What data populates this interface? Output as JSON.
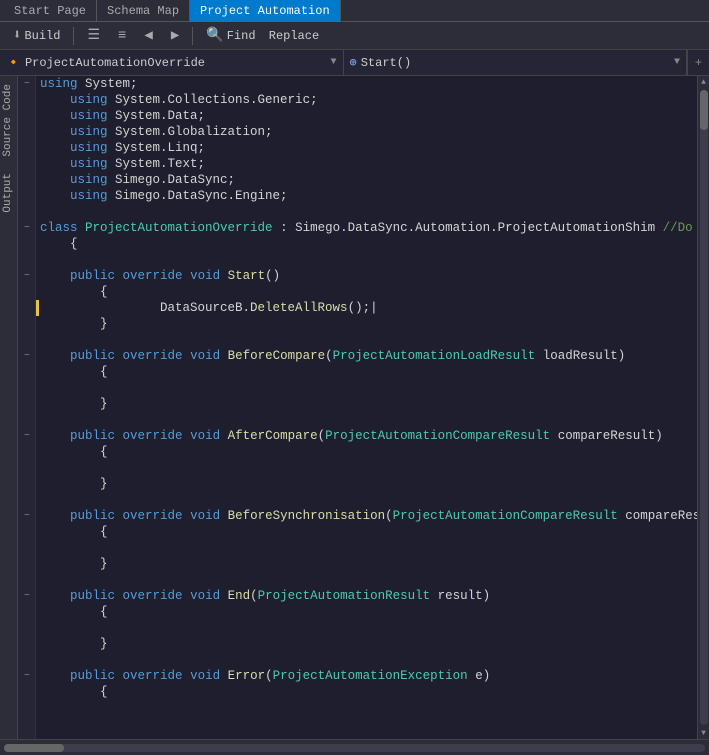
{
  "tabs": [
    {
      "label": "Start Page",
      "active": false
    },
    {
      "label": "Schema Map",
      "active": false
    },
    {
      "label": "Project Automation",
      "active": true
    }
  ],
  "toolbar": {
    "build_label": "Build",
    "find_label": "Find",
    "replace_label": "Replace"
  },
  "nav": {
    "class_dropdown": "ProjectAutomationOverride",
    "method_dropdown": "Start()"
  },
  "code": {
    "lines": [
      {
        "indent": 0,
        "collapse": "minus",
        "content": [
          {
            "t": "kw",
            "v": "using"
          },
          {
            "t": "plain",
            "v": " System;"
          }
        ]
      },
      {
        "indent": 1,
        "content": [
          {
            "t": "kw",
            "v": "using"
          },
          {
            "t": "plain",
            "v": " System.Collections.Generic;"
          }
        ]
      },
      {
        "indent": 1,
        "content": [
          {
            "t": "kw",
            "v": "using"
          },
          {
            "t": "plain",
            "v": " System.Data;"
          }
        ]
      },
      {
        "indent": 1,
        "content": [
          {
            "t": "kw",
            "v": "using"
          },
          {
            "t": "plain",
            "v": " System.Globalization;"
          }
        ]
      },
      {
        "indent": 1,
        "content": [
          {
            "t": "kw",
            "v": "using"
          },
          {
            "t": "plain",
            "v": " System.Linq;"
          }
        ]
      },
      {
        "indent": 1,
        "content": [
          {
            "t": "kw",
            "v": "using"
          },
          {
            "t": "plain",
            "v": " System.Text;"
          }
        ]
      },
      {
        "indent": 1,
        "content": [
          {
            "t": "kw",
            "v": "using"
          },
          {
            "t": "plain",
            "v": " Simego.DataSync;"
          }
        ]
      },
      {
        "indent": 1,
        "content": [
          {
            "t": "kw",
            "v": "using"
          },
          {
            "t": "plain",
            "v": " Simego.DataSync.Engine;"
          }
        ]
      },
      {
        "indent": 0,
        "content": []
      },
      {
        "indent": 0,
        "collapse": "minus",
        "content": [
          {
            "t": "kw",
            "v": "class"
          },
          {
            "t": "plain",
            "v": " "
          },
          {
            "t": "type",
            "v": "ProjectAutomationOverride"
          },
          {
            "t": "plain",
            "v": " : Simego.DataSync.Automation.ProjectAutomationShim "
          },
          {
            "t": "comment",
            "v": "//Do Not"
          }
        ]
      },
      {
        "indent": 1,
        "content": [
          {
            "t": "plain",
            "v": "{"
          }
        ]
      },
      {
        "indent": 0,
        "content": []
      },
      {
        "indent": 1,
        "collapse": "minus",
        "content": [
          {
            "t": "kw",
            "v": "public"
          },
          {
            "t": "plain",
            "v": " "
          },
          {
            "t": "kw",
            "v": "override"
          },
          {
            "t": "plain",
            "v": " "
          },
          {
            "t": "kw",
            "v": "void"
          },
          {
            "t": "plain",
            "v": " "
          },
          {
            "t": "method",
            "v": "Start"
          },
          {
            "t": "plain",
            "v": "()"
          }
        ]
      },
      {
        "indent": 2,
        "content": [
          {
            "t": "plain",
            "v": "{"
          }
        ]
      },
      {
        "indent": 2,
        "bookmark": true,
        "content": [
          {
            "t": "plain",
            "v": "        DataSourceB."
          },
          {
            "t": "method",
            "v": "DeleteAllRows"
          },
          {
            "t": "plain",
            "v": "();|"
          }
        ]
      },
      {
        "indent": 2,
        "content": [
          {
            "t": "plain",
            "v": "}"
          }
        ]
      },
      {
        "indent": 0,
        "content": []
      },
      {
        "indent": 1,
        "collapse": "minus",
        "content": [
          {
            "t": "kw",
            "v": "public"
          },
          {
            "t": "plain",
            "v": " "
          },
          {
            "t": "kw",
            "v": "override"
          },
          {
            "t": "plain",
            "v": " "
          },
          {
            "t": "kw",
            "v": "void"
          },
          {
            "t": "plain",
            "v": " "
          },
          {
            "t": "method",
            "v": "BeforeCompare"
          },
          {
            "t": "plain",
            "v": "("
          },
          {
            "t": "type",
            "v": "ProjectAutomationLoadResult"
          },
          {
            "t": "plain",
            "v": " loadResult)"
          }
        ]
      },
      {
        "indent": 2,
        "content": [
          {
            "t": "plain",
            "v": "{"
          }
        ]
      },
      {
        "indent": 0,
        "content": []
      },
      {
        "indent": 2,
        "content": [
          {
            "t": "plain",
            "v": "}"
          }
        ]
      },
      {
        "indent": 0,
        "content": []
      },
      {
        "indent": 1,
        "collapse": "minus",
        "content": [
          {
            "t": "kw",
            "v": "public"
          },
          {
            "t": "plain",
            "v": " "
          },
          {
            "t": "kw",
            "v": "override"
          },
          {
            "t": "plain",
            "v": " "
          },
          {
            "t": "kw",
            "v": "void"
          },
          {
            "t": "plain",
            "v": " "
          },
          {
            "t": "method",
            "v": "AfterCompare"
          },
          {
            "t": "plain",
            "v": "("
          },
          {
            "t": "type",
            "v": "ProjectAutomationCompareResult"
          },
          {
            "t": "plain",
            "v": " compareResult)"
          }
        ]
      },
      {
        "indent": 2,
        "content": [
          {
            "t": "plain",
            "v": "{"
          }
        ]
      },
      {
        "indent": 0,
        "content": []
      },
      {
        "indent": 2,
        "content": [
          {
            "t": "plain",
            "v": "}"
          }
        ]
      },
      {
        "indent": 0,
        "content": []
      },
      {
        "indent": 1,
        "collapse": "minus",
        "content": [
          {
            "t": "kw",
            "v": "public"
          },
          {
            "t": "plain",
            "v": " "
          },
          {
            "t": "kw",
            "v": "override"
          },
          {
            "t": "plain",
            "v": " "
          },
          {
            "t": "kw",
            "v": "void"
          },
          {
            "t": "plain",
            "v": " "
          },
          {
            "t": "method",
            "v": "BeforeSynchronisation"
          },
          {
            "t": "plain",
            "v": "("
          },
          {
            "t": "type",
            "v": "ProjectAutomationCompareResult"
          },
          {
            "t": "plain",
            "v": " compareResult)"
          }
        ]
      },
      {
        "indent": 2,
        "content": [
          {
            "t": "plain",
            "v": "{"
          }
        ]
      },
      {
        "indent": 0,
        "content": []
      },
      {
        "indent": 2,
        "content": [
          {
            "t": "plain",
            "v": "}"
          }
        ]
      },
      {
        "indent": 0,
        "content": []
      },
      {
        "indent": 1,
        "collapse": "minus",
        "content": [
          {
            "t": "kw",
            "v": "public"
          },
          {
            "t": "plain",
            "v": " "
          },
          {
            "t": "kw",
            "v": "override"
          },
          {
            "t": "plain",
            "v": " "
          },
          {
            "t": "kw",
            "v": "void"
          },
          {
            "t": "plain",
            "v": " "
          },
          {
            "t": "method",
            "v": "End"
          },
          {
            "t": "plain",
            "v": "("
          },
          {
            "t": "type",
            "v": "ProjectAutomationResult"
          },
          {
            "t": "plain",
            "v": " result)"
          }
        ]
      },
      {
        "indent": 2,
        "content": [
          {
            "t": "plain",
            "v": "{"
          }
        ]
      },
      {
        "indent": 0,
        "content": []
      },
      {
        "indent": 2,
        "content": [
          {
            "t": "plain",
            "v": "}"
          }
        ]
      },
      {
        "indent": 0,
        "content": []
      },
      {
        "indent": 1,
        "collapse": "minus",
        "content": [
          {
            "t": "kw",
            "v": "public"
          },
          {
            "t": "plain",
            "v": " "
          },
          {
            "t": "kw",
            "v": "override"
          },
          {
            "t": "plain",
            "v": " "
          },
          {
            "t": "kw",
            "v": "void"
          },
          {
            "t": "plain",
            "v": " "
          },
          {
            "t": "method",
            "v": "Error"
          },
          {
            "t": "plain",
            "v": "("
          },
          {
            "t": "type",
            "v": "ProjectAutomationException"
          },
          {
            "t": "plain",
            "v": " e)"
          }
        ]
      },
      {
        "indent": 2,
        "content": [
          {
            "t": "plain",
            "v": "{"
          }
        ]
      }
    ]
  },
  "colors": {
    "tab_active_bg": "#007acc",
    "toolbar_bg": "#2d2d3a",
    "editor_bg": "#1e1e2e",
    "sidebar_bg": "#2d2d3a"
  }
}
